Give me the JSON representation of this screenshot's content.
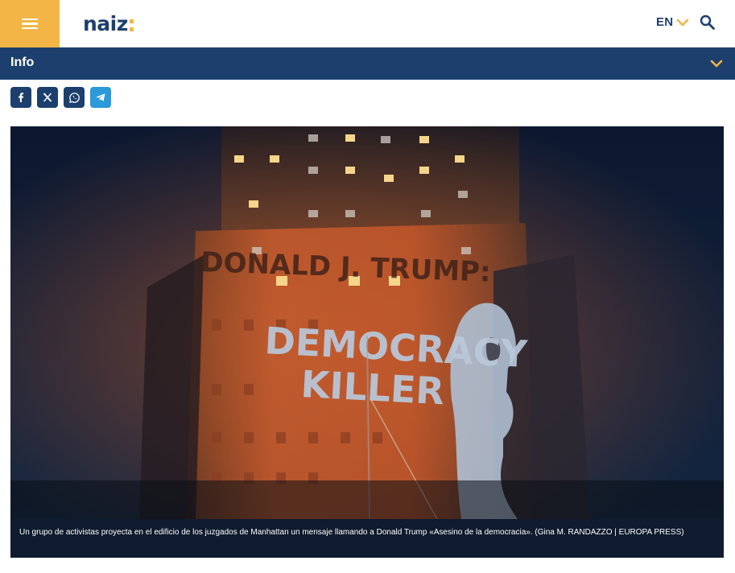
{
  "header": {
    "menu_icon": "hamburger-icon",
    "logo_text": "naiz",
    "language": "EN",
    "search_icon": "search-icon",
    "brand_color": "#1c3f6e",
    "accent_color": "#f3b545"
  },
  "info_bar": {
    "label": "Info",
    "chevron_icon": "chevron-down-icon"
  },
  "share": {
    "buttons": [
      {
        "icon": "facebook-icon"
      },
      {
        "icon": "x-twitter-icon"
      },
      {
        "icon": "whatsapp-icon"
      },
      {
        "icon": "telegram-icon"
      }
    ]
  },
  "figure": {
    "projection_text_top": "DONALD J. TRUMP:",
    "projection_text_line1": "DEMOCRACY",
    "projection_text_line2": "KILLER",
    "caption": "Un grupo de activistas proyecta en el edificio de los juzgados de Manhattan un mensaje llamando a Donald Trump «Asesino de la democracia». (Gina M. RANDAZZO | EUROPA PRESS)"
  }
}
